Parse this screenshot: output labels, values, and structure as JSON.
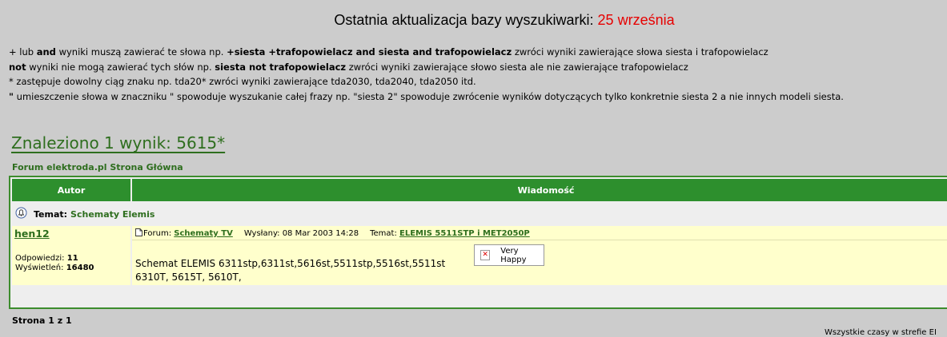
{
  "update": {
    "label": "Ostatnia aktualizacja bazy wyszukiwarki:",
    "date": "25 września"
  },
  "help": {
    "line1": {
      "prefix": "+ lub ",
      "op": "and",
      "mid": " wyniki muszą zawierać te słowa np. ",
      "example": "+siesta +trafopowielacz and siesta and trafopowielacz",
      "suffix": " zwróci wyniki zawierające słowa siesta i trafopowielacz"
    },
    "line2": {
      "op": "not",
      "mid": " wyniki nie mogą zawierać tych słów np. ",
      "example": "siesta not trafopowielacz",
      "suffix": " zwróci wyniki zawierające słowo siesta ale nie zawierające trafopowielacz"
    },
    "line3": "* zastępuje dowolny ciąg znaku np. tda20* zwróci wyniki zawierające tda2030, tda2040, tda2050 itd.",
    "line4": {
      "op": "\"",
      "text": " umieszczenie słowa w znaczniku \" spowoduje wyszukanie całej frazy np. \"siesta 2\" spowoduje zwrócenie wyników dotyczących tylko konkretnie siesta 2 a nie innych modeli siesta."
    }
  },
  "results_title": "Znaleziono 1 wynik: 5615*",
  "forum_link": "Forum elektroda.pl Strona Główna",
  "table": {
    "col_author": "Autor",
    "col_message": "Wiadomość",
    "topic_label": "Temat:",
    "topic_name": "Schematy Elemis",
    "author": "hen12",
    "replies_label": "Odpowiedzi:",
    "replies": "11",
    "views_label": "Wyświetleń:",
    "views": "16480",
    "forum_label": "Forum:",
    "forum_name": "Schematy TV",
    "sent_label": "Wysłany: 08 Mar 2003 14:28",
    "topic2_label": "Temat:",
    "topic2_name": "ELEMIS 5511STP i MET2050P",
    "body": "Schemat ELEMIS 6311stp,6311st,5616st,5511stp,5516st,5511st 6310T, 5615T, 5610T,",
    "emoticon_label": "Very Happy"
  },
  "pages": "Strona 1 z 1",
  "timezone": "Wszystkie czasy w strefie EI"
}
